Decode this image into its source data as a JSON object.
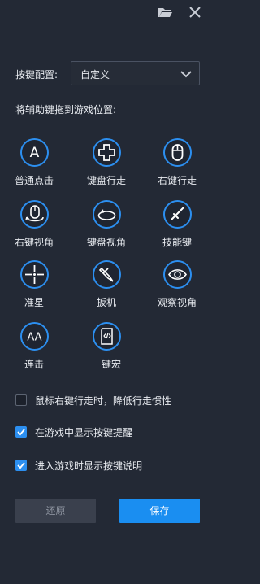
{
  "topbar": {
    "folder_icon": "folder-open-icon",
    "close_icon": "close-icon"
  },
  "config": {
    "label": "按键配置:",
    "selected": "自定义"
  },
  "hint": "将辅助键拖到游戏位置:",
  "keys": [
    {
      "label": "普通点击",
      "icon": "letter-a-icon"
    },
    {
      "label": "键盘行走",
      "icon": "dpad-icon"
    },
    {
      "label": "右键行走",
      "icon": "mouse-icon"
    },
    {
      "label": "右键视角",
      "icon": "mouse-rotate-icon"
    },
    {
      "label": "键盘视角",
      "icon": "rotate-view-icon"
    },
    {
      "label": "技能键",
      "icon": "sword-icon"
    },
    {
      "label": "准星",
      "icon": "crosshair-icon"
    },
    {
      "label": "扳机",
      "icon": "trigger-icon"
    },
    {
      "label": "观察视角",
      "icon": "eye-icon"
    },
    {
      "label": "连击",
      "icon": "letters-aa-icon"
    },
    {
      "label": "一键宏",
      "icon": "macro-script-icon"
    }
  ],
  "options": [
    {
      "label": "鼠标右键行走时，降低行走惯性",
      "checked": false
    },
    {
      "label": "在游戏中显示按键提醒",
      "checked": true
    },
    {
      "label": "进入游戏时显示按键说明",
      "checked": true
    }
  ],
  "buttons": {
    "reset": "还原",
    "save": "保存"
  },
  "colors": {
    "background": "#232935",
    "accent": "#2c8ff0",
    "save_button": "#1a8ef1",
    "reset_button": "#3a404d"
  }
}
